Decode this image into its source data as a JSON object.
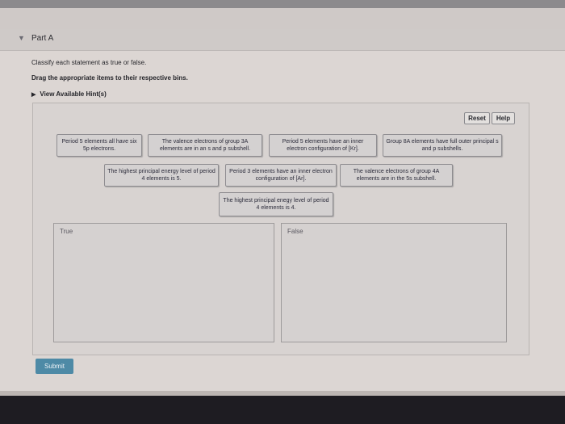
{
  "part": {
    "title": "Part A"
  },
  "instructions": {
    "line1": "Classify each statement as true or false.",
    "line2": "Drag the appropriate items to their respective bins."
  },
  "hints": {
    "label": "View Available Hint(s)"
  },
  "toolbar": {
    "reset_label": "Reset",
    "help_label": "Help"
  },
  "items": [
    "Period 5 elements all have six 5p electrons.",
    "The valence electrons of group 3A elements are in an s and p subshell.",
    "Period 5 elements have an inner electron configuration of [Kr].",
    "Group 8A elements have full outer principal s and p subshells.",
    "The highest principal energy level of period 4 elements is 5.",
    "Period 3 elements have an inner electron configuration of [Ar].",
    "The valence electrons of group 4A elements are in the 5s subshell.",
    "The highest principal enegy level of period 4 elements is 4."
  ],
  "bins": {
    "true_label": "True",
    "false_label": "False"
  },
  "submit_label": "Submit",
  "colors": {
    "submit": "#4e8aa6",
    "panel": "#d8d3d1",
    "tile": "#d4d1d1"
  }
}
